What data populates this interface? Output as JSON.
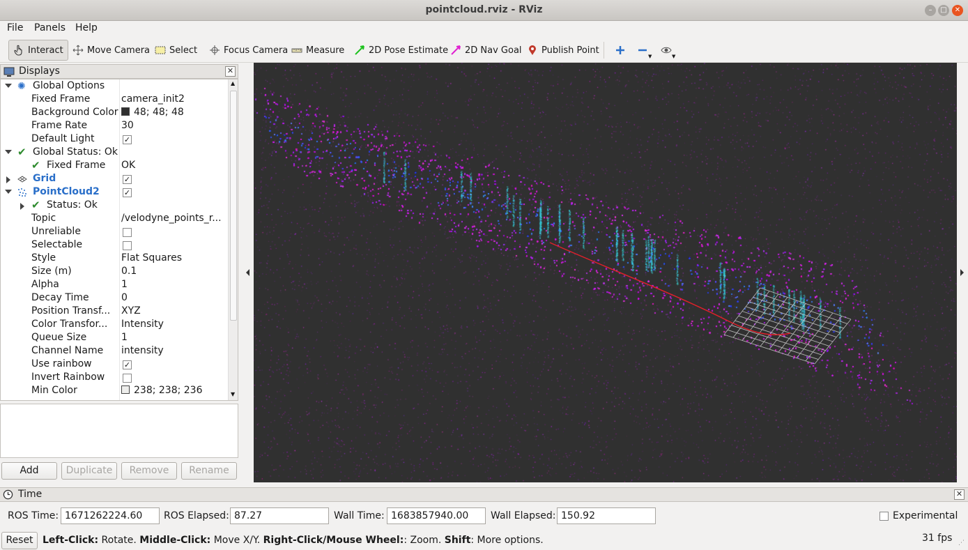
{
  "window": {
    "title": "pointcloud.rviz - RViz"
  },
  "menu": {
    "file": "File",
    "panels": "Panels",
    "help": "Help"
  },
  "toolbar": {
    "interact": "Interact",
    "move_camera": "Move Camera",
    "select": "Select",
    "focus_camera": "Focus Camera",
    "measure": "Measure",
    "pose_estimate": "2D Pose Estimate",
    "nav_goal": "2D Nav Goal",
    "publish_point": "Publish Point"
  },
  "displays": {
    "title": "Displays",
    "global_options": "Global Options",
    "fixed_frame_label": "Fixed Frame",
    "fixed_frame_value": "camera_init2",
    "background_color_label": "Background Color",
    "background_color_value": "48; 48; 48",
    "frame_rate_label": "Frame Rate",
    "frame_rate_value": "30",
    "default_light_label": "Default Light",
    "global_status": "Global Status: Ok",
    "status_fixed_frame_label": "Fixed Frame",
    "status_fixed_frame_value": "OK",
    "grid": "Grid",
    "pointcloud": "PointCloud2",
    "pc_status": "Status: Ok",
    "topic_label": "Topic",
    "topic_value": "/velodyne_points_r...",
    "unreliable_label": "Unreliable",
    "selectable_label": "Selectable",
    "style_label": "Style",
    "style_value": "Flat Squares",
    "size_label": "Size (m)",
    "size_value": "0.1",
    "alpha_label": "Alpha",
    "alpha_value": "1",
    "decay_label": "Decay Time",
    "decay_value": "0",
    "pos_transform_label": "Position Transf...",
    "pos_transform_value": "XYZ",
    "color_transform_label": "Color Transfor...",
    "color_transform_value": "Intensity",
    "queue_label": "Queue Size",
    "queue_value": "1",
    "channel_label": "Channel Name",
    "channel_value": "intensity",
    "use_rainbow_label": "Use rainbow",
    "invert_rainbow_label": "Invert Rainbow",
    "min_color_label": "Min Color",
    "min_color_value": "238; 238; 236"
  },
  "buttons": {
    "add": "Add",
    "duplicate": "Duplicate",
    "remove": "Remove",
    "rename": "Rename"
  },
  "time": {
    "title": "Time",
    "ros_time_label": "ROS Time:",
    "ros_time_value": "1671262224.60",
    "ros_elapsed_label": "ROS Elapsed:",
    "ros_elapsed_value": "87.27",
    "wall_time_label": "Wall Time:",
    "wall_time_value": "1683857940.00",
    "wall_elapsed_label": "Wall Elapsed:",
    "wall_elapsed_value": "150.92",
    "experimental_label": "Experimental"
  },
  "status": {
    "reset": "Reset",
    "left_click": "Left-Click:",
    "left_click_desc": " Rotate. ",
    "middle_click": "Middle-Click:",
    "middle_click_desc": " Move X/Y. ",
    "right_click": "Right-Click/Mouse Wheel:",
    "right_click_desc": ": Zoom. ",
    "shift": "Shift",
    "shift_desc": ": More options.",
    "fps": "31 fps"
  },
  "colors": {
    "viewport_bg": "#303030",
    "accent_blue": "#2a6fc9",
    "check_green": "#2e8b2e"
  }
}
